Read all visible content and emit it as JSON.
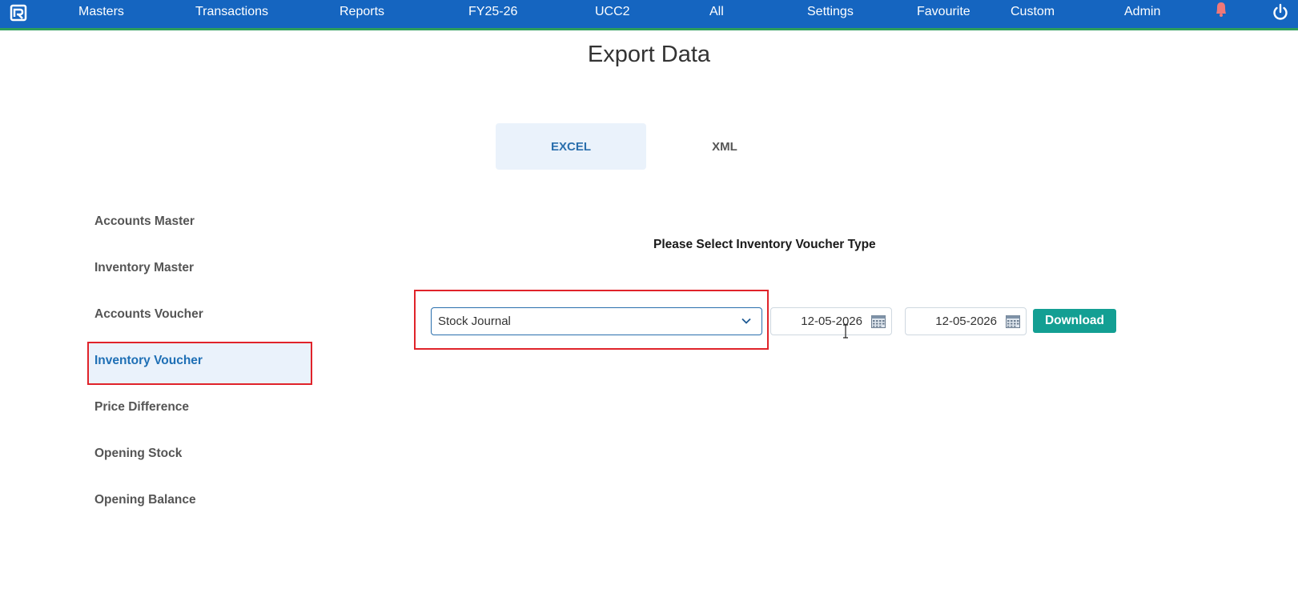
{
  "colors": {
    "topbar": "#1565c0",
    "topbar_accent": "#2e9e5b",
    "active_blue": "#1e6fb5",
    "highlight_red": "#e0232a",
    "download_teal": "#139f93"
  },
  "topbar": {
    "logo_icon": "app-logo-icon",
    "items": [
      {
        "label": "Masters"
      },
      {
        "label": "Transactions"
      },
      {
        "label": "Reports"
      },
      {
        "label": "FY25-26"
      },
      {
        "label": "UCC2"
      },
      {
        "label": "All"
      },
      {
        "label": "Settings"
      },
      {
        "label": "Favourite"
      },
      {
        "label": "Custom"
      },
      {
        "label": "Admin"
      }
    ],
    "bell_icon": "bell-icon",
    "power_icon": "power-icon"
  },
  "page": {
    "title": "Export Data"
  },
  "tabs": [
    {
      "label": "EXCEL",
      "active": true
    },
    {
      "label": "XML",
      "active": false
    }
  ],
  "sidebar": {
    "items": [
      {
        "label": "Accounts Master"
      },
      {
        "label": "Inventory Master"
      },
      {
        "label": "Accounts Voucher"
      },
      {
        "label": "Inventory Voucher",
        "active": true
      },
      {
        "label": "Price Difference"
      },
      {
        "label": "Opening Stock"
      },
      {
        "label": "Opening Balance"
      }
    ]
  },
  "main": {
    "prompt": "Please Select Inventory Voucher Type",
    "voucher_type": {
      "selected": "Stock Journal"
    },
    "from_date": "12-05-2026",
    "to_date": "12-05-2026",
    "download_label": "Download"
  }
}
